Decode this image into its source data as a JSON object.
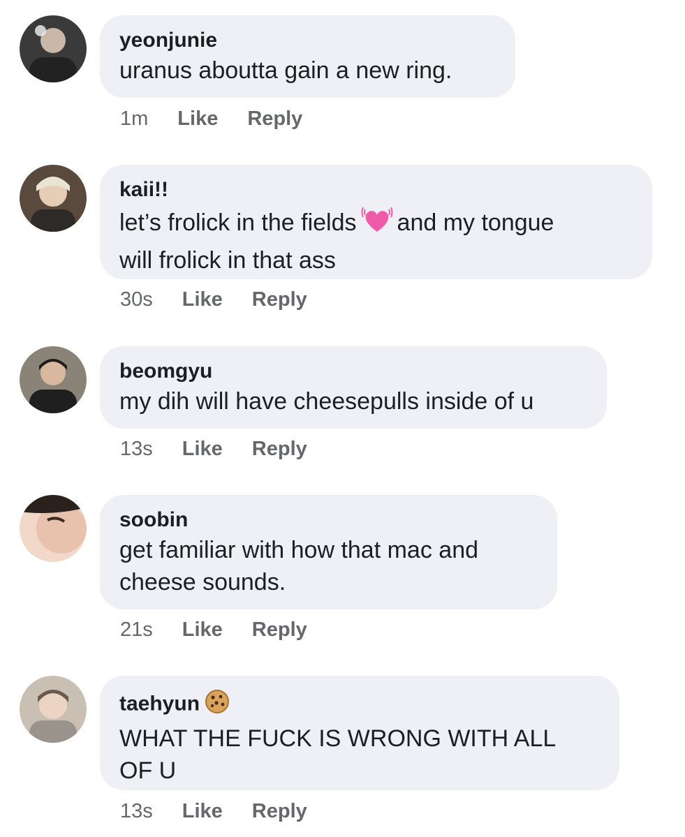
{
  "comments": [
    {
      "author": "yeonjunie",
      "text": [
        "uranus aboutta gain a new ring."
      ],
      "time": "1m",
      "like": "Like",
      "reply": "Reply"
    },
    {
      "author": "kaii!!",
      "text_a": "let’s frolick in the fields",
      "emoji": "beating-heart",
      "text_b": "and my tongue",
      "text_c": "will frolick in that ass",
      "time": "30s",
      "like": "Like",
      "reply": "Reply"
    },
    {
      "author": "beomgyu",
      "text": [
        "my dih will have cheesepulls inside of u"
      ],
      "time": "13s",
      "like": "Like",
      "reply": "Reply"
    },
    {
      "author": "soobin",
      "text": [
        "get familiar with how that mac and",
        "cheese sounds."
      ],
      "time": "21s",
      "like": "Like",
      "reply": "Reply"
    },
    {
      "author": "taehyun",
      "author_emoji": "cookie",
      "text": [
        "WHAT THE FUCK IS WRONG WITH ALL",
        "OF U"
      ],
      "time": "13s",
      "like": "Like",
      "reply": "Reply"
    }
  ],
  "colors": {
    "bubble": "#eff0f5",
    "meta": "#65676b",
    "text": "#1c1e21"
  }
}
